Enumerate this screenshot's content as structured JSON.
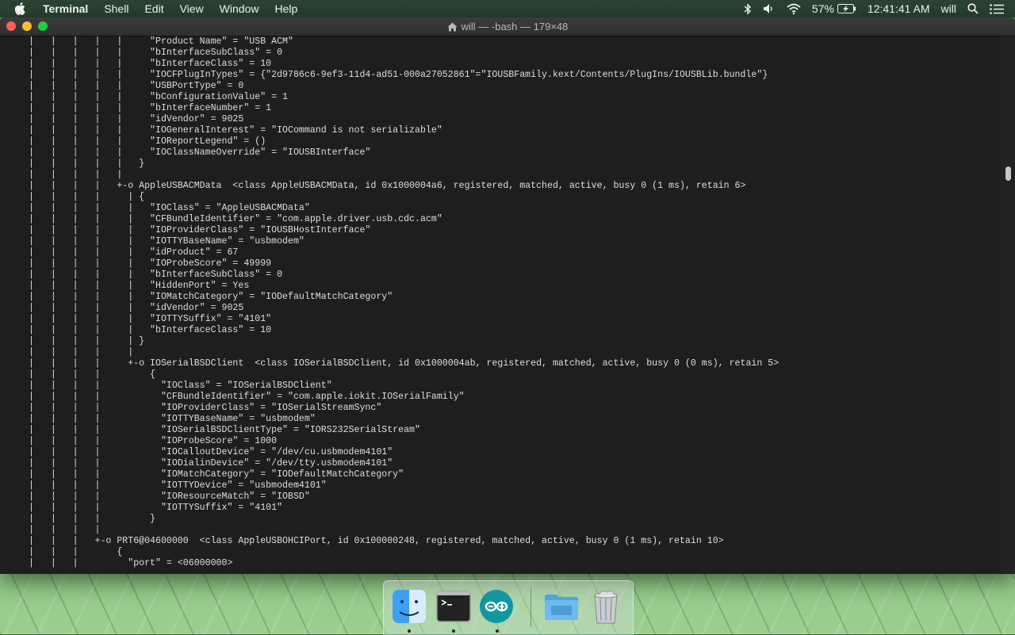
{
  "menubar": {
    "app_name": "Terminal",
    "items": [
      "Shell",
      "Edit",
      "View",
      "Window",
      "Help"
    ],
    "battery": "57%",
    "clock": "12:41:41 AM",
    "user": "will"
  },
  "window": {
    "title": "will — -bash — 179×48"
  },
  "terminal": {
    "lines": [
      "|   |   |   |   |     \"Product Name\" = \"USB ACM\"",
      "|   |   |   |   |     \"bInterfaceSubClass\" = 0",
      "|   |   |   |   |     \"bInterfaceClass\" = 10",
      "|   |   |   |   |     \"IOCFPlugInTypes\" = {\"2d9786c6-9ef3-11d4-ad51-000a27052861\"=\"IOUSBFamily.kext/Contents/PlugIns/IOUSBLib.bundle\"}",
      "|   |   |   |   |     \"USBPortType\" = 0",
      "|   |   |   |   |     \"bConfigurationValue\" = 1",
      "|   |   |   |   |     \"bInterfaceNumber\" = 1",
      "|   |   |   |   |     \"idVendor\" = 9025",
      "|   |   |   |   |     \"IOGeneralInterest\" = \"IOCommand is not serializable\"",
      "|   |   |   |   |     \"IOReportLegend\" = ()",
      "|   |   |   |   |     \"IOClassNameOverride\" = \"IOUSBInterface\"",
      "|   |   |   |   |   }",
      "|   |   |   |   |",
      "|   |   |   |   +-o AppleUSBACMData  <class AppleUSBACMData, id 0x1000004a6, registered, matched, active, busy 0 (1 ms), retain 6>",
      "|   |   |   |     | {",
      "|   |   |   |     |   \"IOClass\" = \"AppleUSBACMData\"",
      "|   |   |   |     |   \"CFBundleIdentifier\" = \"com.apple.driver.usb.cdc.acm\"",
      "|   |   |   |     |   \"IOProviderClass\" = \"IOUSBHostInterface\"",
      "|   |   |   |     |   \"IOTTYBaseName\" = \"usbmodem\"",
      "|   |   |   |     |   \"idProduct\" = 67",
      "|   |   |   |     |   \"IOProbeScore\" = 49999",
      "|   |   |   |     |   \"bInterfaceSubClass\" = 0",
      "|   |   |   |     |   \"HiddenPort\" = Yes",
      "|   |   |   |     |   \"IOMatchCategory\" = \"IODefaultMatchCategory\"",
      "|   |   |   |     |   \"idVendor\" = 9025",
      "|   |   |   |     |   \"IOTTYSuffix\" = \"4101\"",
      "|   |   |   |     |   \"bInterfaceClass\" = 10",
      "|   |   |   |     | }",
      "|   |   |   |     |",
      "|   |   |   |     +-o IOSerialBSDClient  <class IOSerialBSDClient, id 0x1000004ab, registered, matched, active, busy 0 (0 ms), retain 5>",
      "|   |   |   |         {",
      "|   |   |   |           \"IOClass\" = \"IOSerialBSDClient\"",
      "|   |   |   |           \"CFBundleIdentifier\" = \"com.apple.iokit.IOSerialFamily\"",
      "|   |   |   |           \"IOProviderClass\" = \"IOSerialStreamSync\"",
      "|   |   |   |           \"IOTTYBaseName\" = \"usbmodem\"",
      "|   |   |   |           \"IOSerialBSDClientType\" = \"IORS232SerialStream\"",
      "|   |   |   |           \"IOProbeScore\" = 1000",
      "|   |   |   |           \"IOCalloutDevice\" = \"/dev/cu.usbmodem4101\"",
      "|   |   |   |           \"IODialinDevice\" = \"/dev/tty.usbmodem4101\"",
      "|   |   |   |           \"IOMatchCategory\" = \"IODefaultMatchCategory\"",
      "|   |   |   |           \"IOTTYDevice\" = \"usbmodem4101\"",
      "|   |   |   |           \"IOResourceMatch\" = \"IOBSD\"",
      "|   |   |   |           \"IOTTYSuffix\" = \"4101\"",
      "|   |   |   |         }",
      "|   |   |   |",
      "|   |   |   +-o PRT6@04600000  <class AppleUSBOHCIPort, id 0x100000248, registered, matched, active, busy 0 (1 ms), retain 10>",
      "|   |   |       {",
      "|   |   |         \"port\" = <06000000>"
    ]
  },
  "dock": {
    "apps": [
      "Finder",
      "Terminal",
      "Arduino",
      "Folder",
      "Trash"
    ]
  }
}
